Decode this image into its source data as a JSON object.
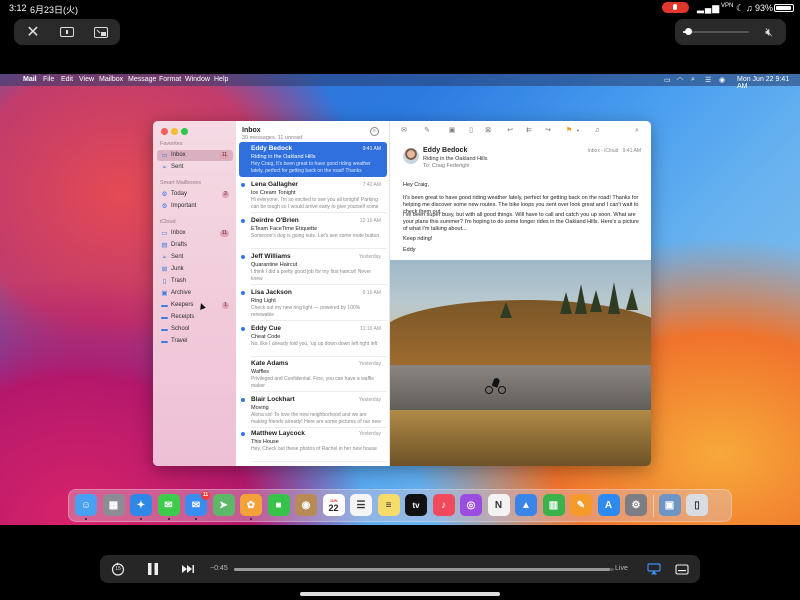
{
  "ipad_status": {
    "time": "3:12",
    "date": "6月23日(火)",
    "battery": "93%"
  },
  "pip_controls": {
    "volume_level": 0.08
  },
  "mac_menubar": {
    "apple": "",
    "items": [
      "Mail",
      "File",
      "Edit",
      "View",
      "Mailbox",
      "Message",
      "Format",
      "Window",
      "Help"
    ],
    "clock": "Mon Jun 22  9:41 AM"
  },
  "sidebar": {
    "favorites_header": "Favorites",
    "favorites": [
      {
        "label": "Inbox",
        "badge": "11",
        "icon": "inbox-icon"
      },
      {
        "label": "Sent",
        "badge": "",
        "icon": "paperplane-icon"
      }
    ],
    "smart_header": "Smart Mailboxes",
    "smart": [
      {
        "label": "Today",
        "badge": "2",
        "icon": "gear-icon"
      },
      {
        "label": "Important",
        "badge": "",
        "icon": "gear-icon"
      }
    ],
    "icloud_header": "iCloud",
    "icloud": [
      {
        "label": "Inbox",
        "badge": "11",
        "icon": "inbox-icon"
      },
      {
        "label": "Drafts",
        "badge": "",
        "icon": "document-icon"
      },
      {
        "label": "Sent",
        "badge": "",
        "icon": "paperplane-icon"
      },
      {
        "label": "Junk",
        "badge": "",
        "icon": "junk-icon"
      },
      {
        "label": "Trash",
        "badge": "",
        "icon": "trash-icon"
      },
      {
        "label": "Archive",
        "badge": "",
        "icon": "archive-icon"
      },
      {
        "label": "Keepers",
        "badge": "1",
        "icon": "folder-icon"
      },
      {
        "label": "Receipts",
        "badge": "",
        "icon": "folder-icon"
      },
      {
        "label": "School",
        "badge": "",
        "icon": "folder-icon"
      },
      {
        "label": "Travel",
        "badge": "",
        "icon": "folder-icon"
      }
    ]
  },
  "message_list": {
    "title": "Inbox",
    "subtitle": "30 messages, 11 unread",
    "messages": [
      {
        "from": "Eddy Bedock",
        "time": "9:41 AM",
        "subject": "Riding in the Oakland Hills",
        "preview": "Hey Craig, It's been great to have good riding weather lately, perfect for getting back on the road! Thanks",
        "unread": false,
        "selected": true
      },
      {
        "from": "Lena Gallagher",
        "time": "7:40 AM",
        "subject": "Ice Cream Tonight",
        "preview": "Hi everyone, I'm so excited to see you all tonight! Parking can be tough so I would arrive early to give yourself some",
        "unread": true,
        "selected": false
      },
      {
        "from": "Deirdre O'Brien",
        "time": "12:16 AM",
        "subject": "ETeam FaceTime Etiquette",
        "preview": "Someone's dog is going nuts. Let's see some mute button",
        "unread": true,
        "selected": false
      },
      {
        "from": "Jeff Williams",
        "time": "Yesterday",
        "subject": "Quarantine Haircut",
        "preview": "I think I did a pretty good job for my first haircut! Never knew",
        "unread": true,
        "selected": false
      },
      {
        "from": "Lisa Jackson",
        "time": "6:16 AM",
        "subject": "Ring Light",
        "preview": "Check out my new ring light — powered by 100% renewable",
        "unread": true,
        "selected": false
      },
      {
        "from": "Eddy Cue",
        "time": "11:16 AM",
        "subject": "Cheat Code",
        "preview": "No, like I already told you, 'up up down down left right left",
        "unread": true,
        "selected": false
      },
      {
        "from": "Kate Adams",
        "time": "Yesterday",
        "subject": "Waffles",
        "preview": "Privileged and Confidential. Fine, you can have a waffle maker",
        "unread": false,
        "selected": false
      },
      {
        "from": "Blair Lockhart",
        "time": "Yesterday",
        "subject": "Moving",
        "preview": "Aloha sis! To love the new neighborhood and we are making friends already! Here are some pictures of our new",
        "unread": true,
        "selected": false
      },
      {
        "from": "Matthew Laycock",
        "time": "Yesterday",
        "subject": "This House",
        "preview": "Hey, Check out these photos of Rachel in her new house",
        "unread": true,
        "selected": false
      }
    ]
  },
  "reader": {
    "from": "Eddy Bedock",
    "subject": "Riding in the Oakland Hills",
    "to_label": "To:",
    "to": "Craig Federighi",
    "mailbox": "Inbox - iCloud",
    "time": "9:41 AM",
    "greeting": "Hey Craig,",
    "para1": "It's been great to have good riding weather lately, perfect for getting back on the road! Thanks for helping me discover some new routes. The bike loops you sent over look great and I can't wait to check them out.",
    "para2": "I've been super busy, but with all good things. Will have to call and catch you up soon. What are your plans this summer? I'm hoping to do some longer rides in the Oakland Hills. Here's a picture of what I'm talking about...",
    "closing": "Keep riding!",
    "signature": "Eddy"
  },
  "dock": {
    "apps": [
      {
        "name": "Finder",
        "color": "#4aa0f0",
        "glyph": "☺"
      },
      {
        "name": "Launchpad",
        "color": "#8c8c96",
        "glyph": "▦"
      },
      {
        "name": "Safari",
        "color": "#2f88e6",
        "glyph": "✦"
      },
      {
        "name": "Messages",
        "color": "#3ccb4a",
        "glyph": "✉"
      },
      {
        "name": "Mail",
        "color": "#3a8df0",
        "glyph": "✉",
        "badge": "11"
      },
      {
        "name": "Maps",
        "color": "#5fb86a",
        "glyph": "➤"
      },
      {
        "name": "Photos",
        "color": "#f3a23a",
        "glyph": "✿"
      },
      {
        "name": "FaceTime",
        "color": "#37c24a",
        "glyph": "■"
      },
      {
        "name": "Contacts",
        "color": "#b88a56",
        "glyph": "◉"
      },
      {
        "name": "Calendar",
        "color": "#ffffff",
        "glyph": "22",
        "dark": true
      },
      {
        "name": "Reminders",
        "color": "#f5f5f5",
        "glyph": "☰",
        "dark": true
      },
      {
        "name": "Notes",
        "color": "#f6dc6a",
        "glyph": "≡",
        "dark": true
      },
      {
        "name": "TV",
        "color": "#111111",
        "glyph": "tv"
      },
      {
        "name": "Music",
        "color": "#f04a5c",
        "glyph": "♪"
      },
      {
        "name": "Podcasts",
        "color": "#9b4de0",
        "glyph": "◎"
      },
      {
        "name": "News",
        "color": "#f3f3f3",
        "glyph": "N",
        "dark": true
      },
      {
        "name": "Keynote",
        "color": "#3a86e8",
        "glyph": "▲"
      },
      {
        "name": "Numbers",
        "color": "#3bb34a",
        "glyph": "▥"
      },
      {
        "name": "Pages",
        "color": "#f39a2a",
        "glyph": "✎"
      },
      {
        "name": "App Store",
        "color": "#2d8af0",
        "glyph": "A"
      },
      {
        "name": "System Preferences",
        "color": "#7d7d84",
        "glyph": "⚙"
      },
      {
        "name": "Preview",
        "color": "#6f95c4",
        "glyph": "▣"
      },
      {
        "name": "Trash",
        "color": "#d8dde3",
        "glyph": "▯",
        "dark": true
      }
    ],
    "calendar_month": "JUN"
  },
  "player": {
    "skip_back": "15",
    "time_remaining": "−0:45",
    "live_label": "Live",
    "progress": 0.99
  }
}
